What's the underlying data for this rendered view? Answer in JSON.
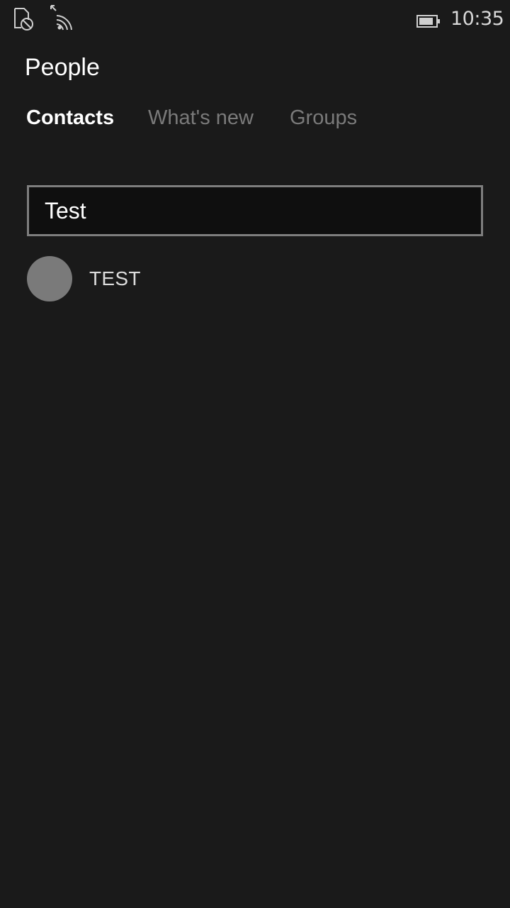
{
  "status_bar": {
    "time": "10:35",
    "icons": [
      "no-sim-icon",
      "wifi-icon",
      "battery-icon"
    ]
  },
  "app": {
    "title": "People"
  },
  "pivot": {
    "tabs": [
      {
        "label": "Contacts",
        "active": true
      },
      {
        "label": "What's new",
        "active": false
      },
      {
        "label": "Groups",
        "active": false
      }
    ]
  },
  "search": {
    "value": "Test",
    "placeholder": ""
  },
  "results": [
    {
      "name": "TEST",
      "avatar": "placeholder-avatar"
    }
  ],
  "colors": {
    "background": "#1a1a1a",
    "inactive_tab": "#7a7a7a",
    "avatar": "#7a7a7a"
  }
}
